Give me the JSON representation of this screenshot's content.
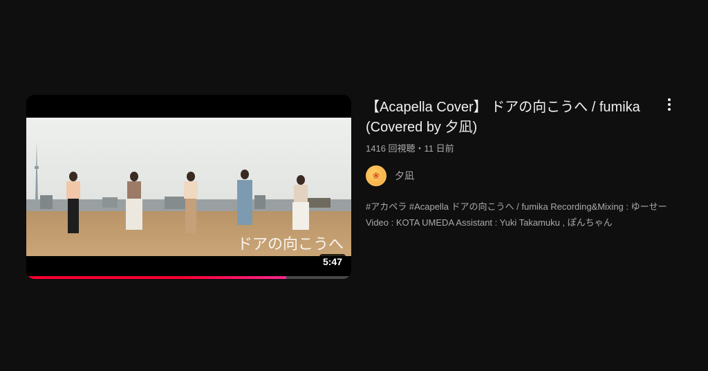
{
  "video": {
    "title": "【Acapella Cover】 ドアの向こうへ / fumika (Covered by 夕凪)",
    "stats": "1416 回視聴・11 日前",
    "duration": "5:47",
    "watch_progress": 0.8,
    "channel": {
      "name": "夕凪",
      "avatar_icon": "channel-avatar-icon"
    },
    "description": "#アカペラ #Acapella ドアの向こうへ / fumika Recording&Mixing : ゆーせー Video : KOTA UMEDA Assistant : Yuki Takamuku , ぽんちゃん",
    "menu_icon": "more-vert-icon"
  },
  "colors": {
    "background": "#0f0f0f",
    "progress": "#ff0033",
    "secondary_text": "#aaaaaa"
  }
}
